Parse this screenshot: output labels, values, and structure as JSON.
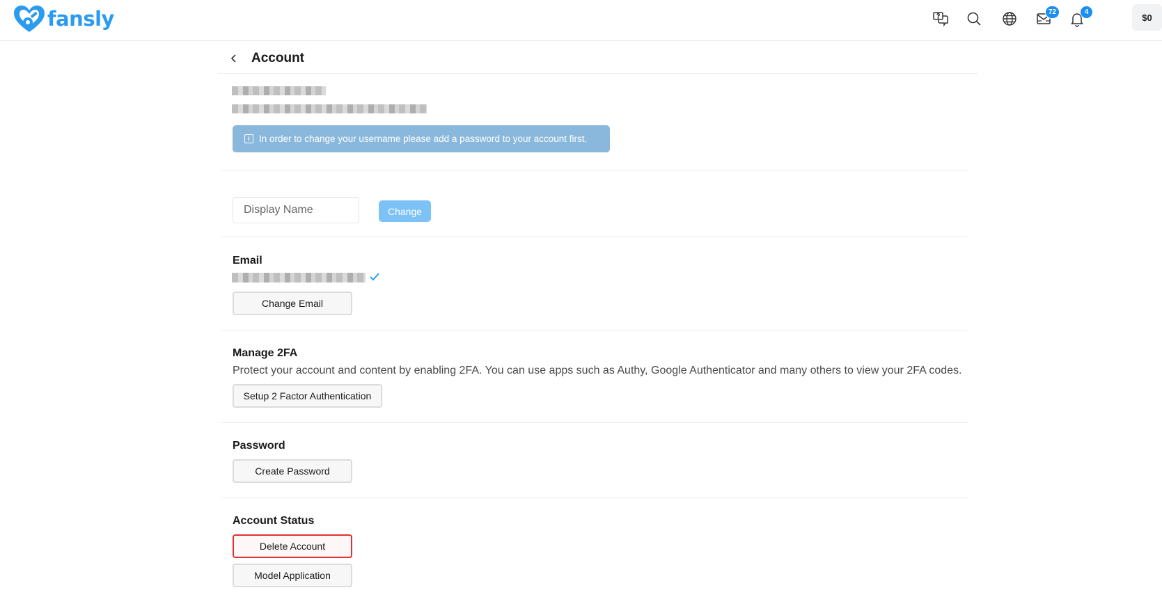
{
  "app": {
    "brand": "fansly",
    "accent_color": "#2b9bf0"
  },
  "topbar": {
    "icons": [
      "support-chat-icon",
      "search-icon",
      "globe-icon",
      "messages-icon",
      "notifications-icon"
    ],
    "messages_badge": "72",
    "notifications_badge": "4",
    "balance": "$0"
  },
  "page": {
    "title": "Account",
    "alert_text": "In order to change your username please add a password to your account first."
  },
  "display_name": {
    "placeholder": "Display Name",
    "change_label": "Change"
  },
  "email": {
    "label": "Email",
    "change_label": "Change Email"
  },
  "twofa": {
    "label": "Manage 2FA",
    "description": "Protect your account and content by enabling 2FA. You can use apps such as Authy, Google Authenticator and many others to view your 2FA codes.",
    "setup_label": "Setup 2 Factor Authentication"
  },
  "password": {
    "label": "Password",
    "create_label": "Create Password"
  },
  "account_status": {
    "label": "Account Status",
    "delete_label": "Delete Account",
    "model_label": "Model Application"
  }
}
